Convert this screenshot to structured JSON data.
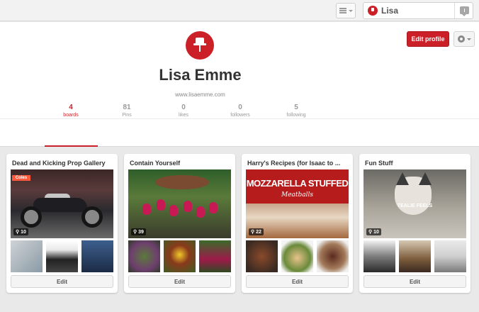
{
  "topbar": {
    "menu_icon": "hamburger-menu-icon",
    "user_name": "Lisa",
    "message_icon": "messages-icon"
  },
  "profile": {
    "name": "Lisa Emme",
    "website": "www.lisaemme.com",
    "edit_profile_label": "Edit profile",
    "settings_icon": "gear-icon"
  },
  "stats": [
    {
      "count": "4",
      "label": "boards",
      "active": true
    },
    {
      "count": "81",
      "label": "Pins",
      "active": false
    },
    {
      "count": "0",
      "label": "likes",
      "active": false
    },
    {
      "count": "0",
      "label": "followers",
      "active": false
    },
    {
      "count": "5",
      "label": "following",
      "active": false
    }
  ],
  "boards": [
    {
      "title": "Dead and Kicking Prop Gallery",
      "pin_count": "10",
      "cover_sign": "Coles",
      "edit_label": "Edit"
    },
    {
      "title": "Contain Yourself",
      "pin_count": "39",
      "edit_label": "Edit"
    },
    {
      "title": "Harry's Recipes (for Isaac to ...",
      "pin_count": "22",
      "cover_line1": "MOZZARELLA STUFFED",
      "cover_line2": "Meatballs",
      "edit_label": "Edit"
    },
    {
      "title": "Fun Stuff",
      "pin_count": "10",
      "cover_caption": "TEALIE FEELS",
      "edit_label": "Edit"
    }
  ],
  "colors": {
    "accent": "#cb2027",
    "page_bg": "#e9e9e9"
  }
}
